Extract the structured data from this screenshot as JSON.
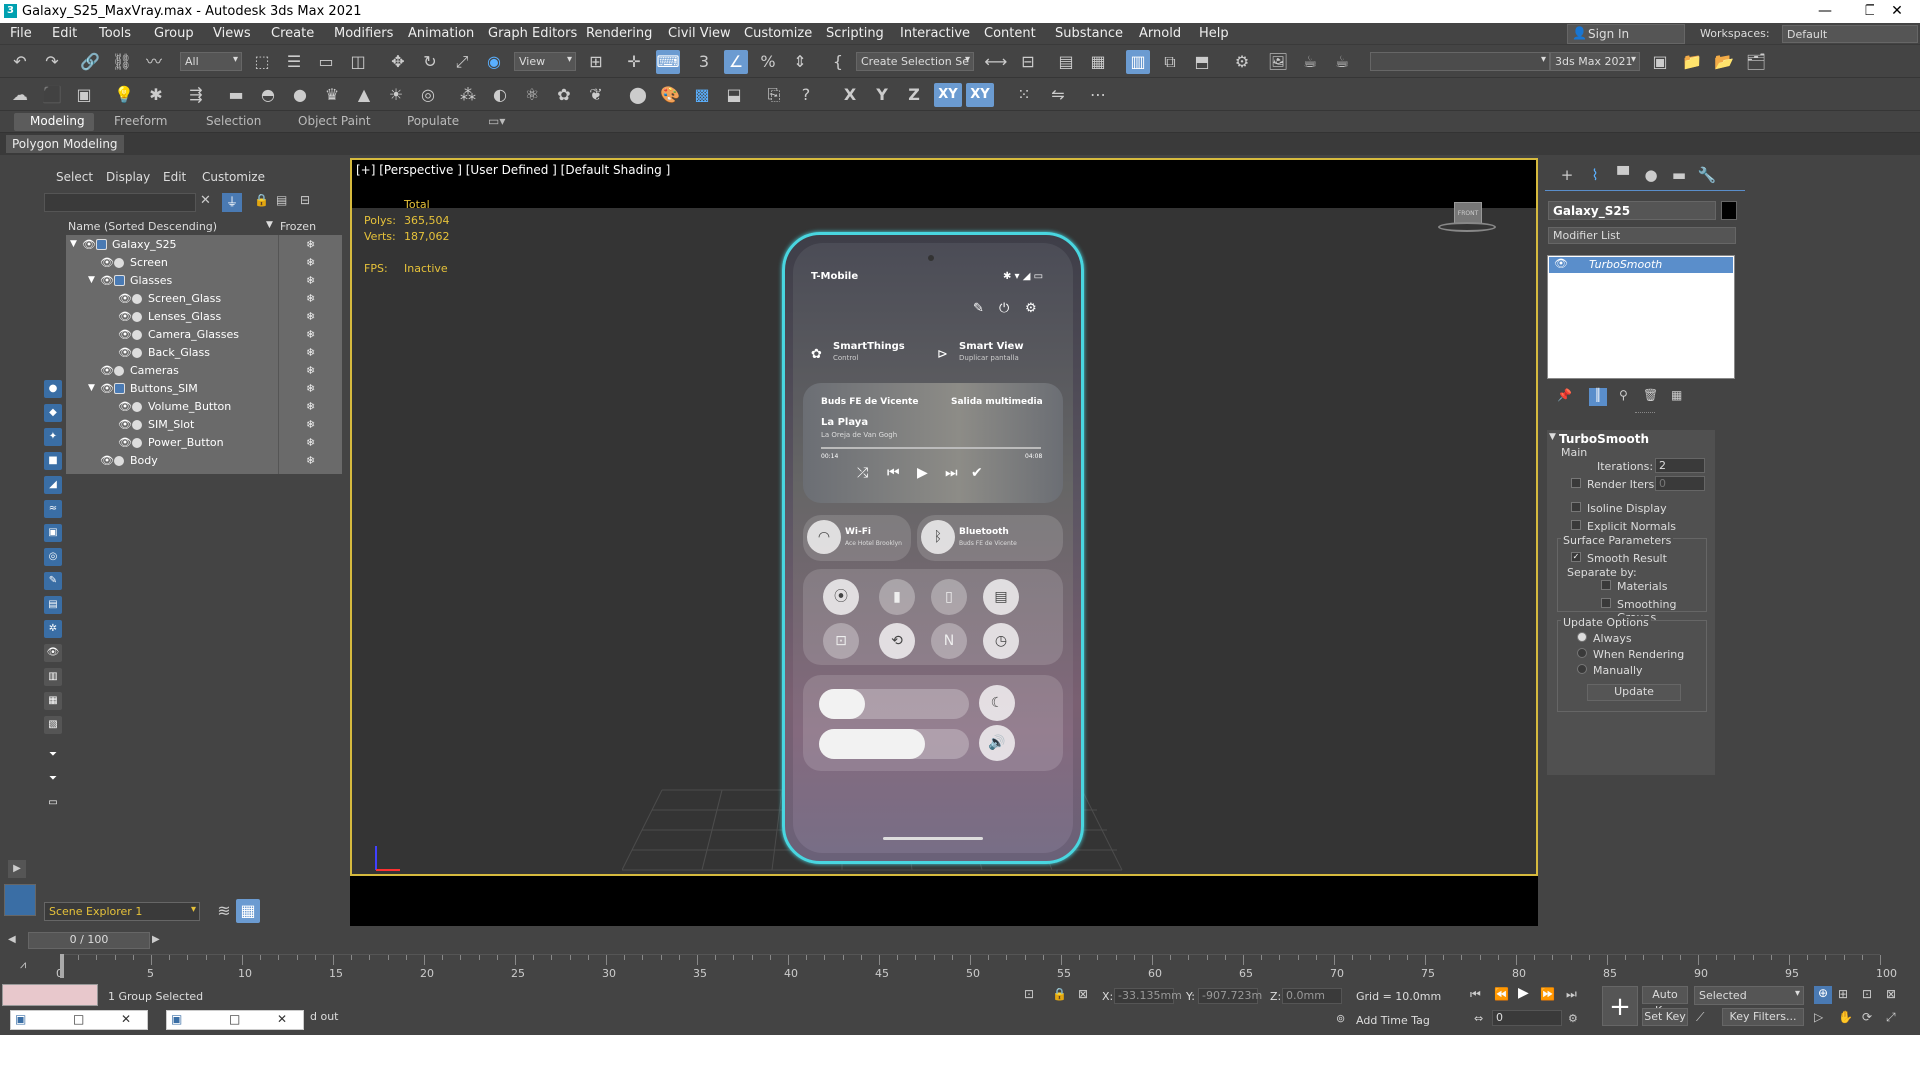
{
  "titlebar": {
    "title": "Galaxy_S25_MaxVray.max - Autodesk 3ds Max 2021",
    "logo": "3",
    "minimize": "—",
    "maximize": "❐",
    "close": "✕"
  },
  "menu": [
    "File",
    "Edit",
    "Tools",
    "Group",
    "Views",
    "Create",
    "Modifiers",
    "Animation",
    "Graph Editors",
    "Rendering",
    "Civil View",
    "Customize",
    "Scripting",
    "Interactive",
    "Content",
    "Substance",
    "Arnold",
    "Help"
  ],
  "account": {
    "signin": "Sign In",
    "workspaces_label": "Workspaces:",
    "workspace": "Default"
  },
  "toolbar": {
    "filter": "All",
    "view": "View",
    "create_selection": "Create Selection Se",
    "product": "3ds Max 2021",
    "axis_x": "X",
    "axis_y": "Y",
    "axis_z": "Z",
    "axis_xy": "XY",
    "axis_xy2": "XY"
  },
  "ribbon": {
    "tabs": [
      "Modeling",
      "Freeform",
      "Selection",
      "Object Paint",
      "Populate"
    ],
    "panel": "Polygon Modeling"
  },
  "scene_explorer": {
    "menu": [
      "Select",
      "Display",
      "Edit",
      "Customize"
    ],
    "col_name": "Name (Sorted Descending)",
    "col_frozen": "Frozen",
    "frozen_glyph": "❄",
    "rows": [
      {
        "name": "Galaxy_S25",
        "level": 0,
        "expand": "▼",
        "type": "group"
      },
      {
        "name": "Screen",
        "level": 1,
        "expand": "",
        "type": "obj"
      },
      {
        "name": "Glasses",
        "level": 1,
        "expand": "▼",
        "type": "group"
      },
      {
        "name": "Screen_Glass",
        "level": 2,
        "expand": "",
        "type": "obj"
      },
      {
        "name": "Lenses_Glass",
        "level": 2,
        "expand": "",
        "type": "obj"
      },
      {
        "name": "Camera_Glasses",
        "level": 2,
        "expand": "",
        "type": "obj"
      },
      {
        "name": "Back_Glass",
        "level": 2,
        "expand": "",
        "type": "obj"
      },
      {
        "name": "Cameras",
        "level": 1,
        "expand": "",
        "type": "obj"
      },
      {
        "name": "Buttons_SIM",
        "level": 1,
        "expand": "▼",
        "type": "group"
      },
      {
        "name": "Volume_Button",
        "level": 2,
        "expand": "",
        "type": "obj"
      },
      {
        "name": "SIM_Slot",
        "level": 2,
        "expand": "",
        "type": "obj"
      },
      {
        "name": "Power_Button",
        "level": 2,
        "expand": "",
        "type": "obj"
      },
      {
        "name": "Body",
        "level": 1,
        "expand": "",
        "type": "obj"
      }
    ],
    "explorer_name": "Scene Explorer 1"
  },
  "viewport": {
    "label": "[+] [Perspective ] [User Defined ] [Default Shading ]",
    "stats_total": "Total",
    "polys_label": "Polys:",
    "polys": "365,504",
    "verts_label": "Verts:",
    "verts": "187,062",
    "fps_label": "FPS:",
    "fps": "Inactive",
    "viewcube": "FRONT"
  },
  "phone": {
    "carrier": "T-Mobile",
    "smartthings": "SmartThings",
    "smartthings_sub": "Control",
    "smartview": "Smart View",
    "smartview_sub": "Duplicar pantalla",
    "device": "Buds FE de Vicente",
    "output": "Salida multimedia",
    "song": "La Playa",
    "artist": "La Oreja de Van Gogh",
    "time_start": "00:14",
    "time_end": "04:08",
    "wifi": "Wi-Fi",
    "wifi_sub": "Ace Hotel Brooklyn",
    "bt": "Bluetooth",
    "bt_sub": "Buds FE de Vicente"
  },
  "command_panel": {
    "object_name": "Galaxy_S25",
    "modifier_list": "Modifier List",
    "modifier": "TurboSmooth",
    "rollout_title": "TurboSmooth",
    "main": "Main",
    "iterations_label": "Iterations:",
    "iterations": "2",
    "render_iters_label": "Render Iters:",
    "render_iters": "0",
    "isoline": "Isoline Display",
    "explicit": "Explicit Normals",
    "surface": "Surface Parameters",
    "smooth_result": "Smooth Result",
    "separate": "Separate by:",
    "materials": "Materials",
    "smoothing_groups": "Smoothing Groups",
    "update_options": "Update Options",
    "always": "Always",
    "when_rendering": "When Rendering",
    "manually": "Manually",
    "update": "Update"
  },
  "timeline": {
    "slider": "0 / 100",
    "ticks": [
      "0",
      "5",
      "10",
      "15",
      "20",
      "25",
      "30",
      "35",
      "40",
      "45",
      "50",
      "55",
      "60",
      "65",
      "70",
      "75",
      "80",
      "85",
      "90",
      "95",
      "100"
    ],
    "status": "1 Group Selected",
    "status2": "d out",
    "x_label": "X:",
    "x": "-33.135mm",
    "y_label": "Y:",
    "y": "-907.723m",
    "z_label": "Z:",
    "z": "0.0mm",
    "grid": "Grid = 10.0mm",
    "add_time_tag": "Add Time Tag",
    "frame": "0",
    "auto_key": "Auto Key",
    "selected": "Selected",
    "set_key": "Set Key",
    "key_filters": "Key Filters..."
  }
}
